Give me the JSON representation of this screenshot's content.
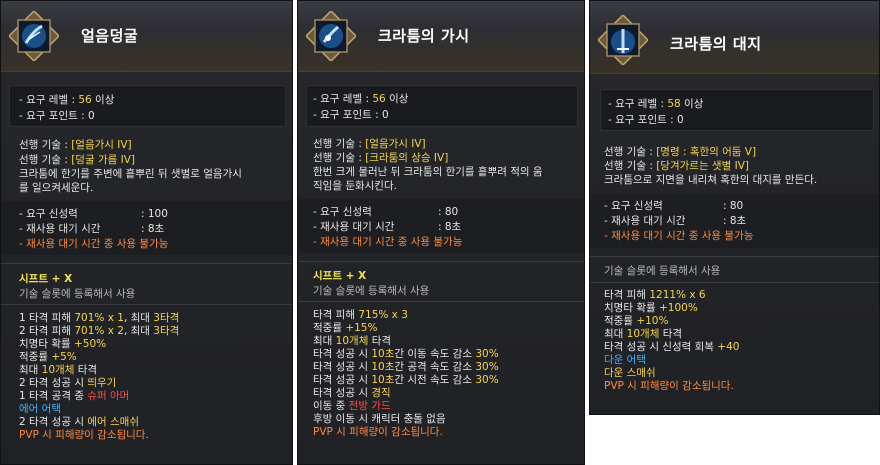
{
  "tooltips": [
    {
      "title": "얼음덩굴",
      "req_level_label": "- 요구 레벨 : ",
      "req_level_value": "56",
      "req_level_suffix": " 이상",
      "req_point": "- 요구 포인트 : 0",
      "pre1_prefix": "선행 기술 : ",
      "pre1_value": "[얼음가시 IV]",
      "pre2_prefix": "선행 기술 : ",
      "pre2_value": "[덩굴 가름 IV]",
      "desc1": "크라툼에 한기를 주변에 흩뿌린 뒤 샛별로 얼음가시",
      "desc2": "를 일으켜세운다.",
      "divinity_label": "- 요구 신성력",
      "divinity_value": ": 100",
      "cooldown_label": "- 재사용 대기 시간",
      "cooldown_value": ": 8초",
      "no_use": "- 재사용 대기 시간 중 사용 불가능",
      "shift": "시프트 + X",
      "slot": "기술 슬롯에 등록해서 사용",
      "stats": [
        {
          "parts": [
            [
              "1 타격 피해 ",
              "w"
            ],
            [
              "701% x 1",
              "y"
            ],
            [
              ", 최대 ",
              "w"
            ],
            [
              "3타격",
              "y"
            ]
          ]
        },
        {
          "parts": [
            [
              "2 타격 피해 ",
              "w"
            ],
            [
              "701% x 2",
              "y"
            ],
            [
              ", 최대 ",
              "w"
            ],
            [
              "3타격",
              "y"
            ]
          ]
        },
        {
          "parts": [
            [
              "치명타 확률 ",
              "w"
            ],
            [
              "+50%",
              "y"
            ]
          ]
        },
        {
          "parts": [
            [
              "적중률 ",
              "w"
            ],
            [
              "+5%",
              "y"
            ]
          ]
        },
        {
          "parts": [
            [
              "최대 ",
              "w"
            ],
            [
              "10개체",
              "y"
            ],
            [
              " 타격",
              "w"
            ]
          ]
        },
        {
          "parts": [
            [
              "2 타격 성공 시 ",
              "w"
            ],
            [
              "띄우기",
              "y"
            ]
          ]
        },
        {
          "parts": [
            [
              "1 타격 공격 중 ",
              "w"
            ],
            [
              "슈퍼 아머",
              "r"
            ]
          ]
        },
        {
          "parts": [
            [
              "에어 어택",
              "b"
            ]
          ]
        },
        {
          "parts": [
            [
              "2 타격 성공 시 ",
              "w"
            ],
            [
              "에어 스매쉬",
              "y"
            ]
          ]
        },
        {
          "parts": [
            [
              "PVP 시 피해량이 감소됩니다.",
              "o"
            ]
          ]
        }
      ]
    },
    {
      "title": "크라툼의 가시",
      "req_level_label": "- 요구 레벨 : ",
      "req_level_value": "56",
      "req_level_suffix": " 이상",
      "req_point": "- 요구 포인트 : 0",
      "pre1_prefix": "선행 기술 : ",
      "pre1_value": "[얼음가시 IV]",
      "pre2_prefix": "선행 기술 : ",
      "pre2_value": "[크라툼의 상승 IV]",
      "desc1": "한번 크게 물러난 뒤 크라툼의 한기를 흩뿌려 적의 움",
      "desc2": "직임을 둔화시킨다.",
      "divinity_label": "- 요구 신성력",
      "divinity_value": ": 80",
      "cooldown_label": "- 재사용 대기 시간",
      "cooldown_value": ": 8초",
      "no_use": "- 재사용 대기 시간 중 사용 불가능",
      "shift": "시프트 + X",
      "slot": "기술 슬롯에 등록해서 사용",
      "stats": [
        {
          "parts": [
            [
              "타격 피해 ",
              "w"
            ],
            [
              "715% x 3",
              "y"
            ]
          ]
        },
        {
          "parts": [
            [
              "적중률 ",
              "w"
            ],
            [
              "+15%",
              "y"
            ]
          ]
        },
        {
          "parts": [
            [
              "최대 ",
              "w"
            ],
            [
              "10개체",
              "y"
            ],
            [
              " 타격",
              "w"
            ]
          ]
        },
        {
          "parts": [
            [
              "타격 성공 시 ",
              "w"
            ],
            [
              "10초",
              "y"
            ],
            [
              "간 이동 속도 감소 ",
              "w"
            ],
            [
              "30%",
              "y"
            ]
          ]
        },
        {
          "parts": [
            [
              "타격 성공 시 ",
              "w"
            ],
            [
              "10초",
              "y"
            ],
            [
              "간 공격 속도 감소 ",
              "w"
            ],
            [
              "30%",
              "y"
            ]
          ]
        },
        {
          "parts": [
            [
              "타격 성공 시 ",
              "w"
            ],
            [
              "10초",
              "y"
            ],
            [
              "간 시전 속도 감소 ",
              "w"
            ],
            [
              "30%",
              "y"
            ]
          ]
        },
        {
          "parts": [
            [
              "타격 성공 시 ",
              "w"
            ],
            [
              "경직",
              "y"
            ]
          ]
        },
        {
          "parts": [
            [
              "이동 중 ",
              "w"
            ],
            [
              "전방 가드",
              "r"
            ]
          ]
        },
        {
          "parts": [
            [
              "후방 이동 시 캐릭터 충돌 없음",
              "w"
            ]
          ]
        },
        {
          "parts": [
            [
              "PVP 시 피해량이 감소됩니다.",
              "o"
            ]
          ]
        }
      ]
    },
    {
      "title": "크라툼의 대지",
      "req_level_label": "- 요구 레벨 : ",
      "req_level_value": "58",
      "req_level_suffix": " 이상",
      "req_point": "- 요구 포인트 : 0",
      "pre1_prefix": "선행 기술 : ",
      "pre1_value": "[명령 : 혹한의 어둠 V]",
      "pre2_prefix": "선행 기술 : ",
      "pre2_value": "[당겨가르는 샛별 IV]",
      "desc1": "크라툼으로 지면을 내리쳐 혹한의 대지를 만든다.",
      "desc2": "",
      "divinity_label": "- 요구 신성력",
      "divinity_value": ": 80",
      "cooldown_label": "- 재사용 대기 시간",
      "cooldown_value": ": 8초",
      "no_use": "- 재사용 대기 시간 중 사용 불가능",
      "shift": "",
      "slot": "기술 슬롯에 등록해서 사용",
      "stats": [
        {
          "parts": [
            [
              "타격 피해 ",
              "w"
            ],
            [
              "1211% x 6",
              "y"
            ]
          ]
        },
        {
          "parts": [
            [
              "치명타 확률 ",
              "w"
            ],
            [
              "+100%",
              "y"
            ]
          ]
        },
        {
          "parts": [
            [
              "적중률 ",
              "w"
            ],
            [
              "+10%",
              "y"
            ]
          ]
        },
        {
          "parts": [
            [
              "최대 ",
              "w"
            ],
            [
              "10개체",
              "y"
            ],
            [
              " 타격",
              "w"
            ]
          ]
        },
        {
          "parts": [
            [
              "타격 성공 시 신성력 회복 ",
              "w"
            ],
            [
              "+40",
              "y"
            ]
          ]
        },
        {
          "parts": [
            [
              "다운 어택",
              "b"
            ]
          ]
        },
        {
          "parts": [
            [
              "다운 스매쉬",
              "y"
            ]
          ]
        },
        {
          "parts": [
            [
              "PVP 시 피해량이 감소됩니다.",
              "o"
            ]
          ]
        }
      ]
    }
  ],
  "colors": {
    "yellow": "#f5d54a",
    "orange": "#ff8a3d",
    "red": "#ff4c4c",
    "blue": "#3fb3ff"
  }
}
